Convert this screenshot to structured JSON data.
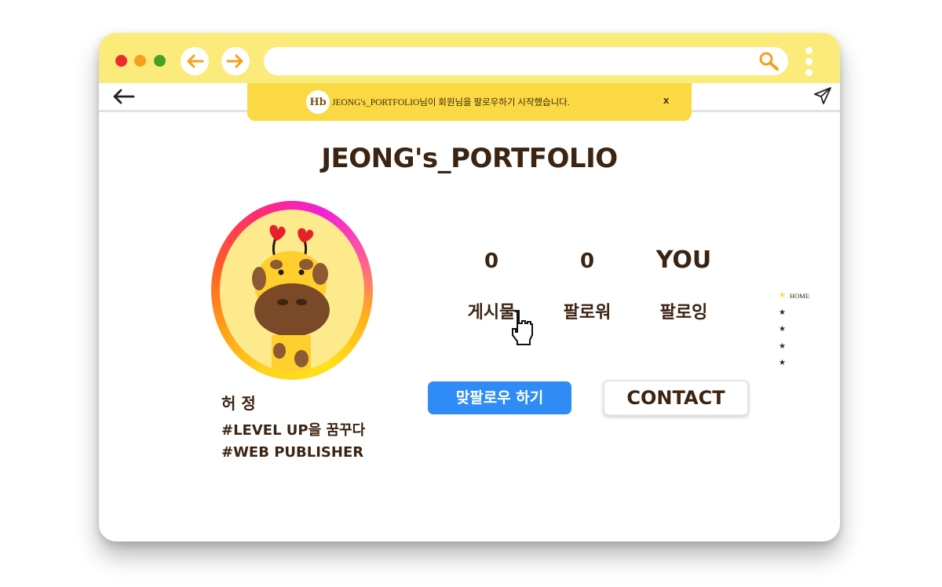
{
  "browser": {
    "window_controls": [
      "close",
      "minimize",
      "maximize"
    ],
    "back_button_icon": "arrow-left-icon",
    "forward_button_icon": "arrow-right-icon",
    "address_value": "",
    "search_icon": "search-icon",
    "menu_icon": "kebab-menu-icon"
  },
  "subbar": {
    "back_icon": "back-arrow-icon",
    "send_icon": "send-icon"
  },
  "notification": {
    "avatar_text": "Hb",
    "message": "JEONG's_PORTFOLIO님이 회원님을 팔로우하기 시작했습니다.",
    "close_label": "x"
  },
  "profile": {
    "brand_title": "JEONG's_PORTFOLIO",
    "avatar_icon": "giraffe-avatar",
    "name": "허 정",
    "tags": [
      "#LEVEL UP을 꿈꾸다",
      "#WEB PUBLISHER"
    ]
  },
  "stats": [
    {
      "value": "0",
      "label": "게시물"
    },
    {
      "value": "0",
      "label": "팔로워"
    },
    {
      "value": "YOU",
      "label": "팔로잉"
    }
  ],
  "actions": {
    "follow_back_label": "맞팔로우 하기",
    "contact_label": "CONTACT"
  },
  "side_nav": {
    "items": [
      {
        "label": "HOME",
        "active": true
      },
      {
        "label": "",
        "active": false
      },
      {
        "label": "",
        "active": false
      },
      {
        "label": "",
        "active": false
      },
      {
        "label": "",
        "active": false
      }
    ]
  },
  "colors": {
    "titlebar": "#fbeb7b",
    "notification": "#fbd944",
    "accent_blue": "#2f8cf6",
    "text_brown": "#3b2412",
    "arrow_orange": "#f5a01d"
  }
}
